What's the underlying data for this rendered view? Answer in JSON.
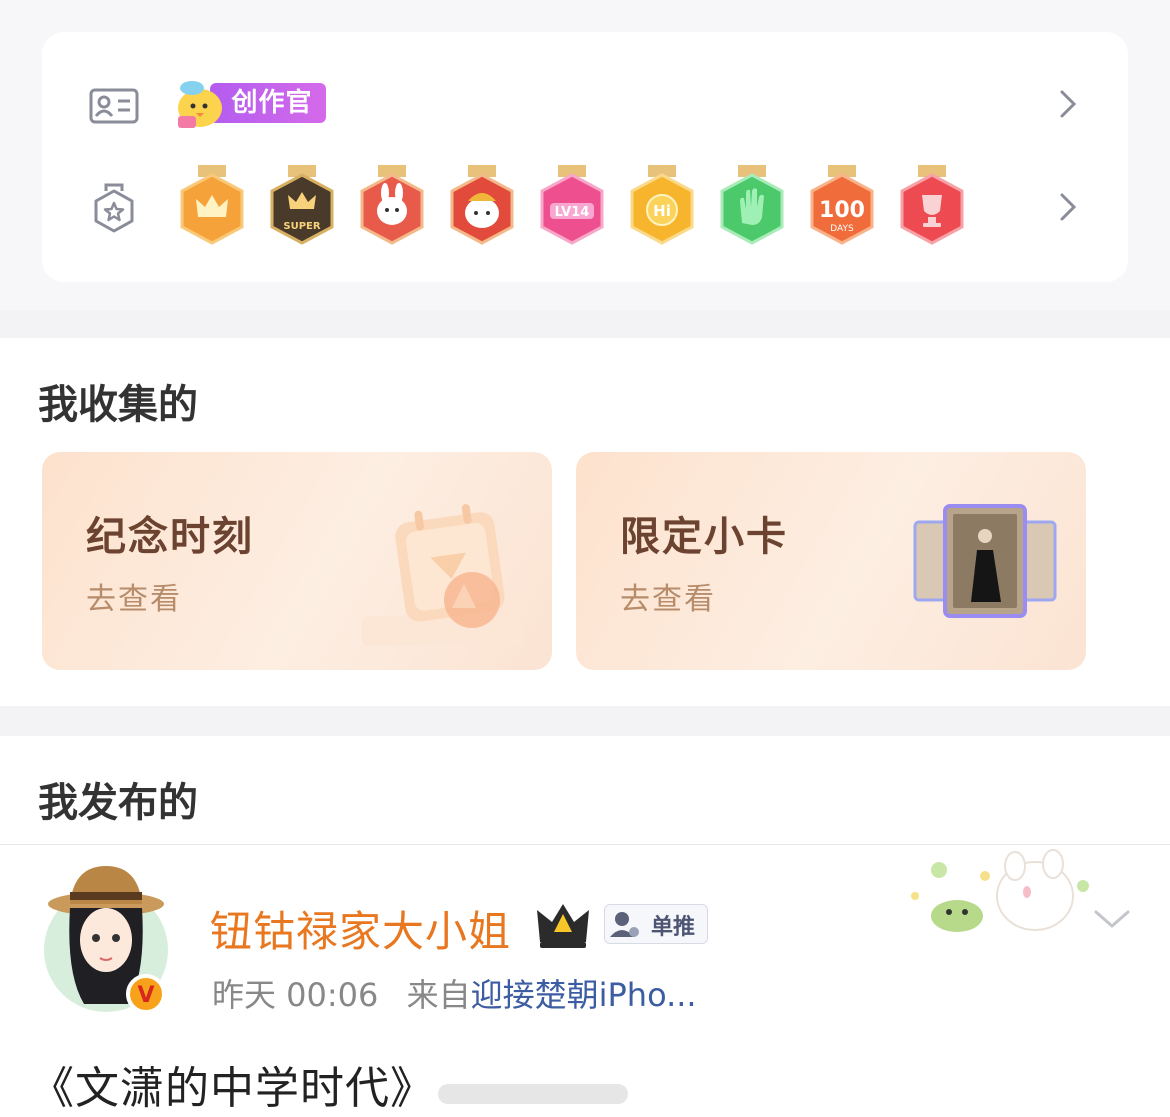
{
  "badges": {
    "creator_label": "创作官",
    "medal_icons": [
      "crown-medal",
      "super-medal",
      "bunny-medal",
      "bunny-hat-medal",
      "lv14-medal",
      "hi-medal",
      "wave-hand-medal",
      "100-days-medal",
      "trophy-medal"
    ],
    "medal_texts": {
      "super": "SUPER",
      "lv": "LV14",
      "hi": "Hi",
      "days_num": "100",
      "days_word": "DAYS"
    }
  },
  "collected": {
    "title": "我收集的",
    "cards": [
      {
        "title": "纪念时刻",
        "subtitle": "去查看"
      },
      {
        "title": "限定小卡",
        "subtitle": "去查看"
      }
    ]
  },
  "published": {
    "title": "我发布的",
    "post": {
      "username": "钮钴禄家大小姐",
      "tag": "单推",
      "verified_mark": "V",
      "time": "昨天 00:06",
      "source_prefix": "来自",
      "source": "迎接楚朝iPho...",
      "text": "《文潇的中学时代》"
    }
  },
  "colors": {
    "username": "#e8771f",
    "source_link": "#3d5da3",
    "creator_pill": "#b35cf0"
  }
}
